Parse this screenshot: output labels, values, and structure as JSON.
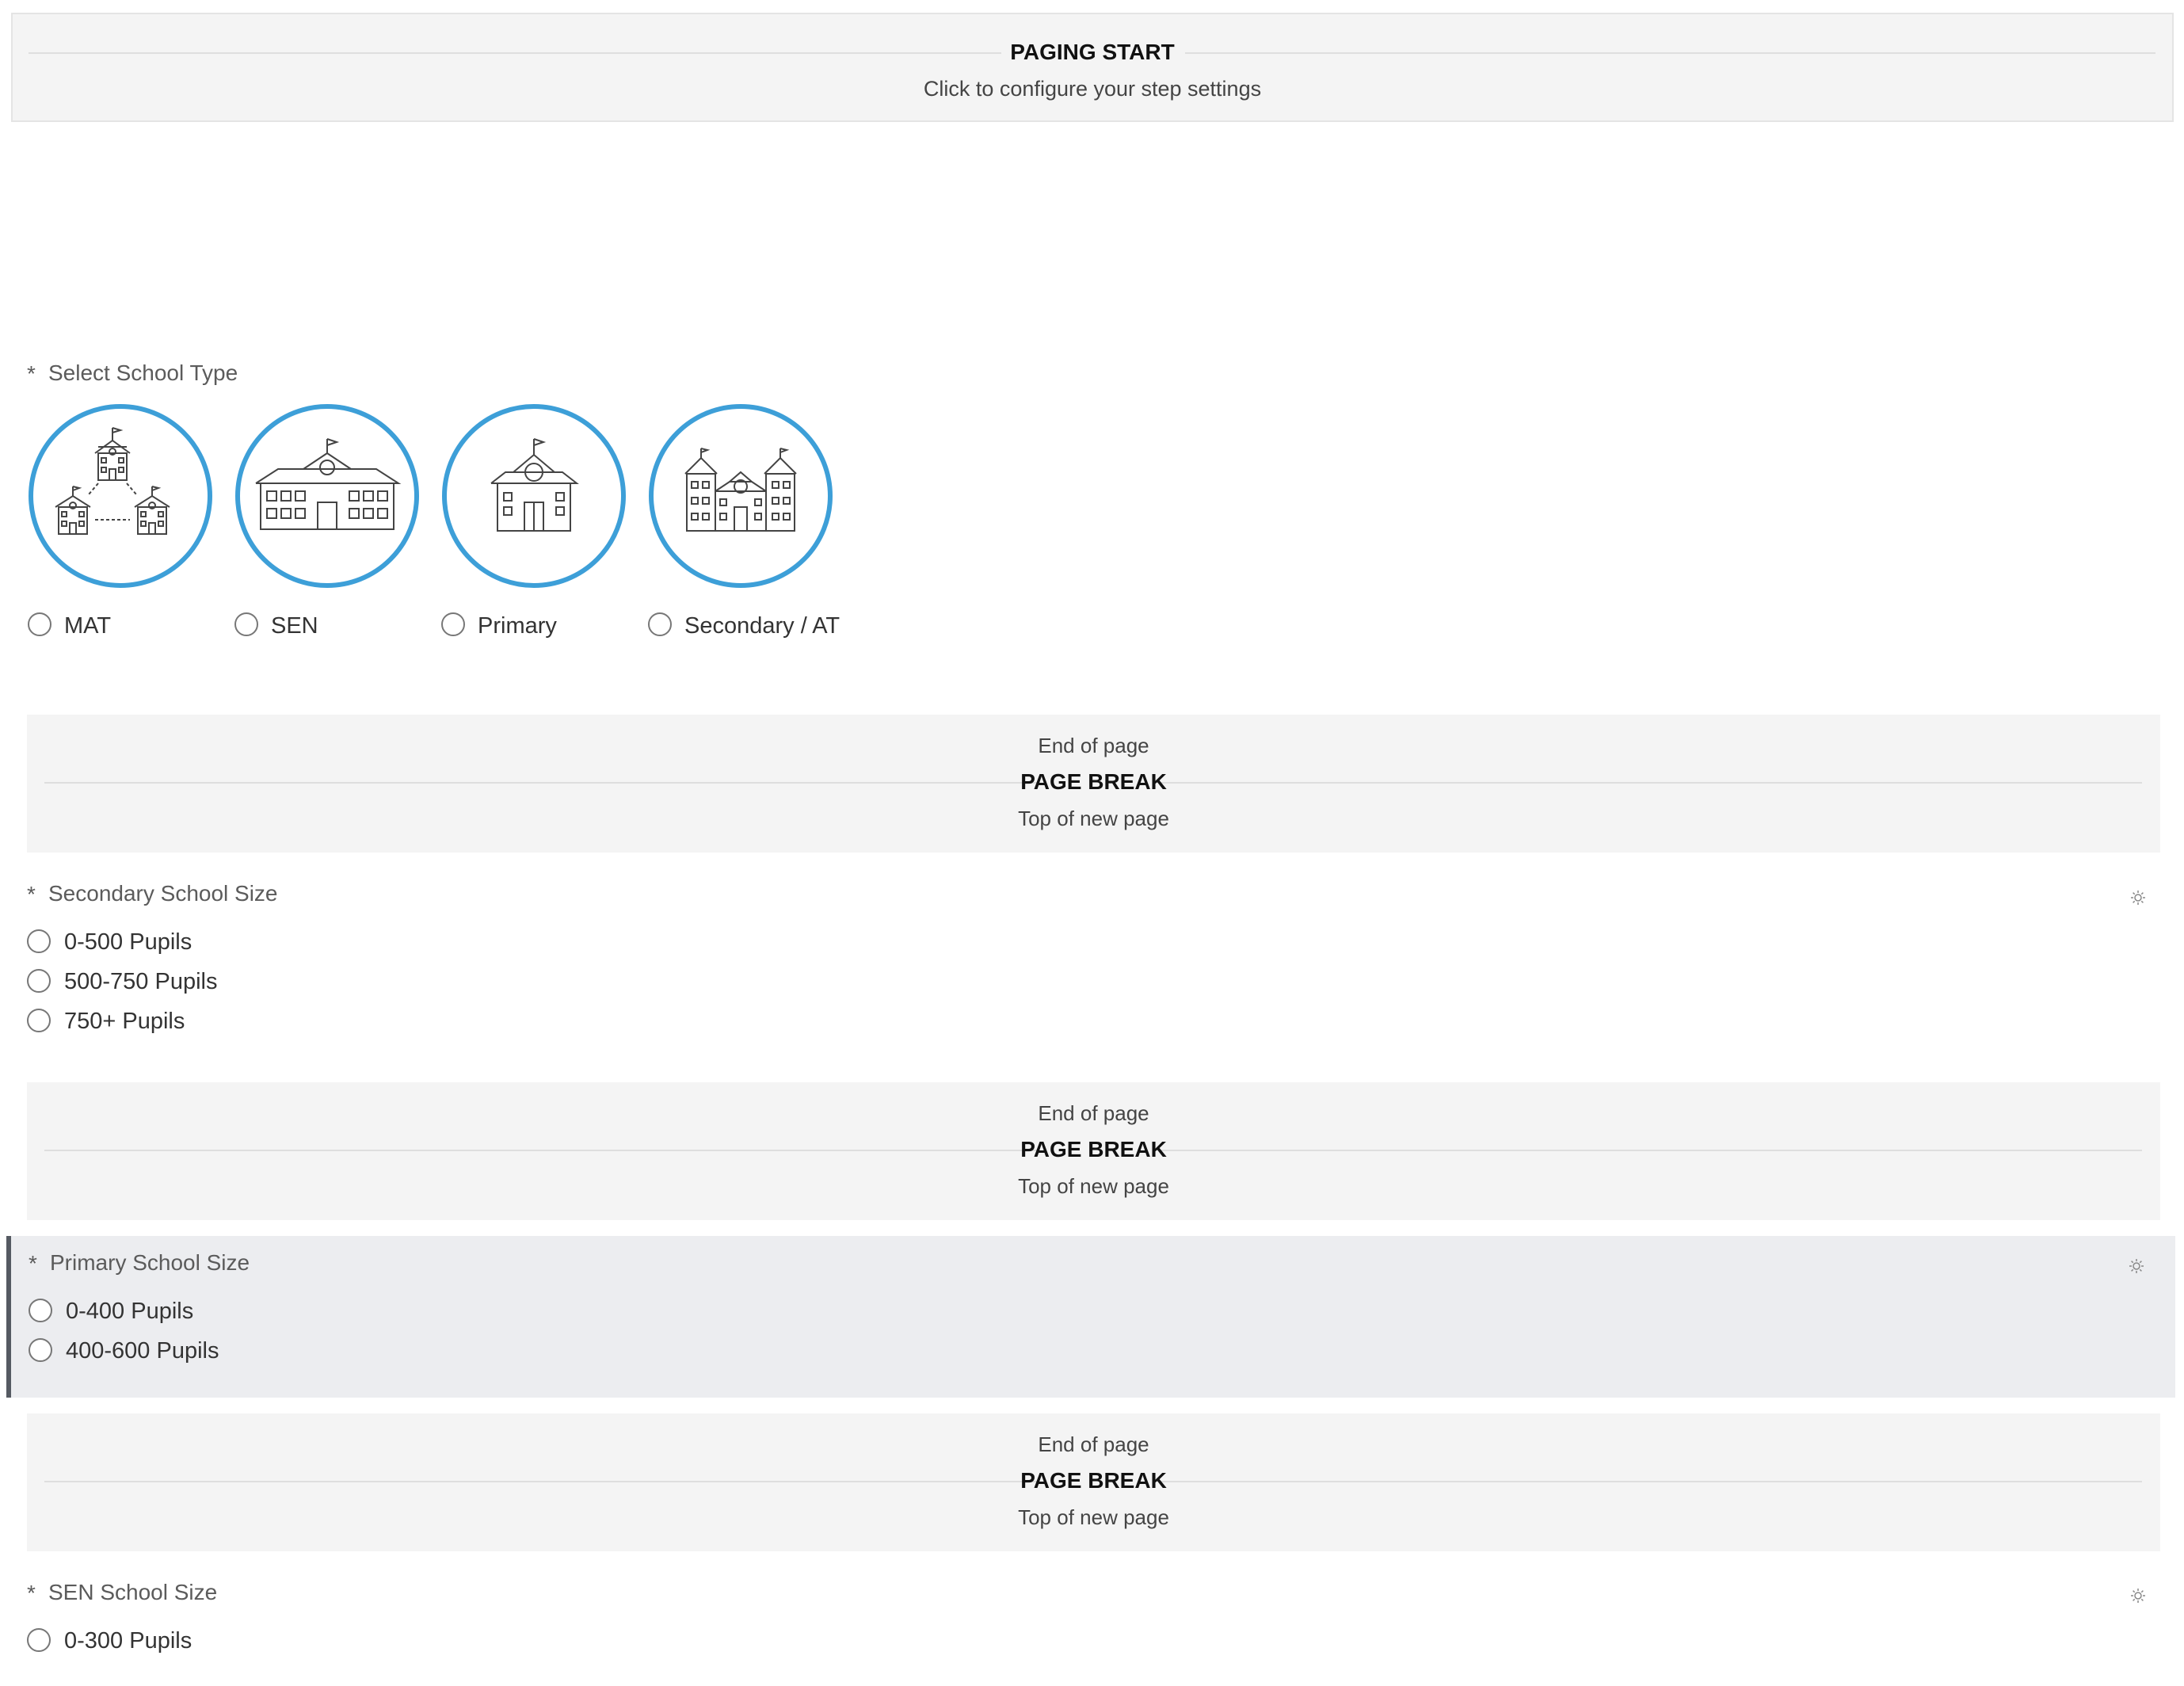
{
  "paging_start": {
    "title": "PAGING START",
    "subtitle": "Click to configure your step settings"
  },
  "school_type": {
    "required_mark": "*",
    "label": "Select School Type",
    "options": [
      {
        "label": "MAT",
        "icon": "trust-network-icon"
      },
      {
        "label": "SEN",
        "icon": "wide-school-icon"
      },
      {
        "label": "Primary",
        "icon": "small-school-icon"
      },
      {
        "label": "Secondary / AT",
        "icon": "campus-school-icon"
      }
    ]
  },
  "page_breaks": [
    {
      "end": "End of page",
      "title": "PAGE BREAK",
      "top": "Top of new page"
    },
    {
      "end": "End of page",
      "title": "PAGE BREAK",
      "top": "Top of new page"
    },
    {
      "end": "End of page",
      "title": "PAGE BREAK",
      "top": "Top of new page"
    }
  ],
  "secondary_size": {
    "required_mark": "*",
    "label": "Secondary School Size",
    "options": [
      "0-500 Pupils",
      "500-750 Pupils",
      "750+ Pupils"
    ]
  },
  "primary_size": {
    "required_mark": "*",
    "label": "Primary School Size",
    "options": [
      "0-400 Pupils",
      "400-600 Pupils"
    ]
  },
  "sen_size": {
    "required_mark": "*",
    "label": "SEN School Size",
    "options": [
      "0-300 Pupils"
    ]
  },
  "colors": {
    "accent_circle": "#3d9fd8",
    "required": "#e25a4a",
    "band_bg": "#f4f4f4",
    "selected_bg": "#ecedf0",
    "selected_bar": "#555a62"
  }
}
